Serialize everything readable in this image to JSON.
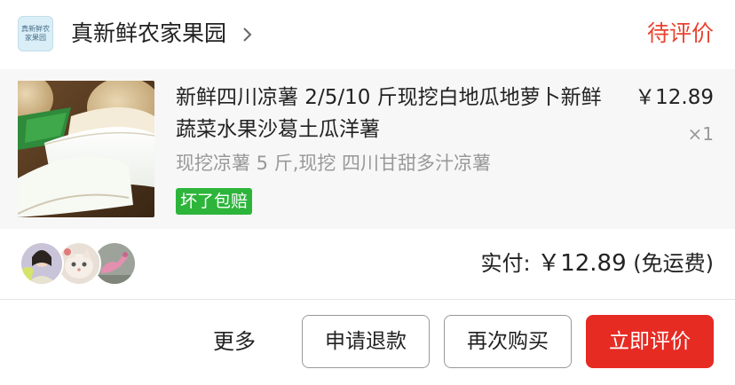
{
  "shop": {
    "logo_text_line1": "真新鲜农",
    "logo_text_line2": "家果园",
    "name": "真新鲜农家果园",
    "status": "待评价"
  },
  "item": {
    "title": "新鲜四川凉薯 2/5/10 斤现挖白地瓜地萝卜新鲜蔬菜水果沙葛土瓜洋薯",
    "price": "￥12.89",
    "quantity": "×1",
    "spec": "现挖凉薯 5 斤,现挖 四川甘甜多汁凉薯",
    "tag": "坏了包赔"
  },
  "summary": {
    "paid_label": "实付:",
    "paid_amount": "￥12.89",
    "shipping_note": "(免运费)"
  },
  "actions": {
    "more": "更多",
    "refund": "申请退款",
    "rebuy": "再次购买",
    "review": "立即评价"
  },
  "colors": {
    "status_red": "#e8432f",
    "primary_button": "#e62b23",
    "tag_green": "#2db53b"
  },
  "icons": [
    "shop-logo",
    "chevron-right-icon",
    "product-thumbnail",
    "buyer-avatar"
  ]
}
